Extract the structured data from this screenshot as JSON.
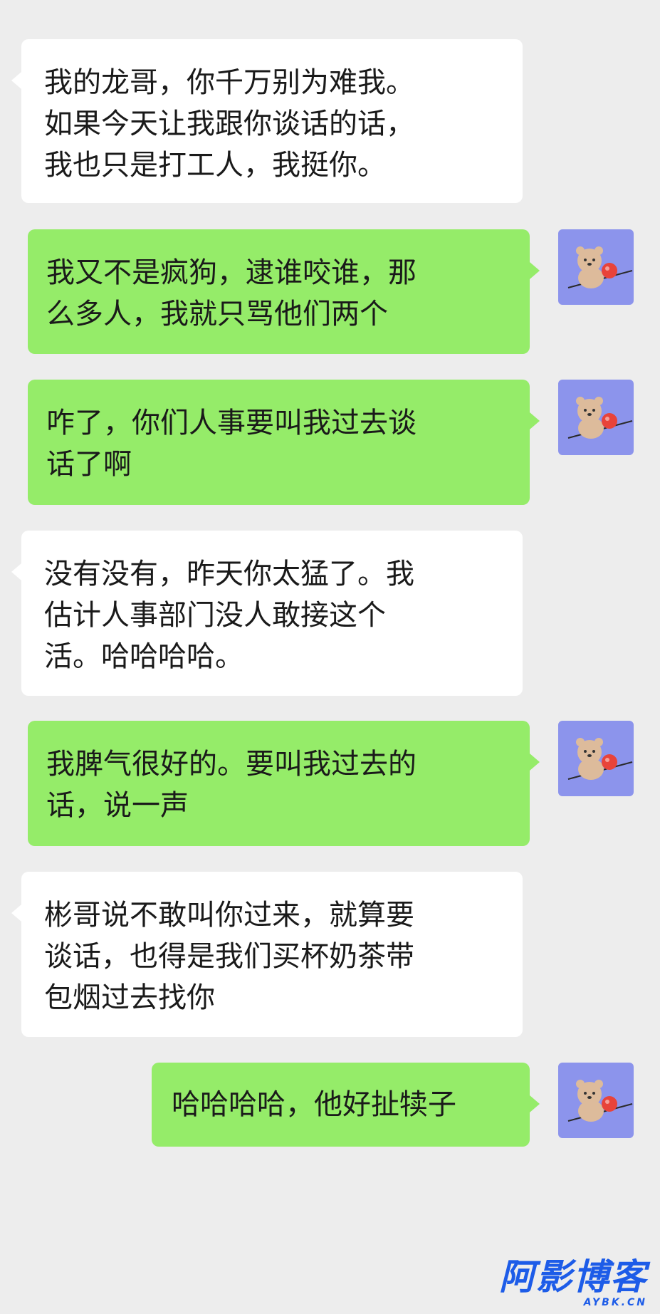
{
  "chat": {
    "messages": [
      {
        "side": "incoming",
        "text": "我的龙哥，你千万别为难我。\n如果今天让我跟你谈话的话，\n我也只是打工人，我挺你。"
      },
      {
        "side": "outgoing",
        "text": "我又不是疯狗，逮谁咬谁，那\n么多人，我就只骂他们两个"
      },
      {
        "side": "outgoing",
        "text": "咋了，你们人事要叫我过去谈\n话了啊"
      },
      {
        "side": "incoming",
        "text": "没有没有，昨天你太猛了。我\n估计人事部门没人敢接这个\n活。哈哈哈哈。"
      },
      {
        "side": "outgoing",
        "text": "我脾气很好的。要叫我过去的\n话，说一声"
      },
      {
        "side": "incoming",
        "text": "彬哥说不敢叫你过来，就算要\n谈话，也得是我们买杯奶茶带\n包烟过去找你"
      },
      {
        "side": "outgoing",
        "text": "哈哈哈哈，他好扯犊子"
      }
    ],
    "avatar_icon": "bear-sticker-avatar-icon",
    "colors": {
      "background": "#ededed",
      "incoming_bubble": "#ffffff",
      "outgoing_bubble": "#95ec69",
      "avatar_bg": "#8c94ec"
    }
  },
  "watermark": {
    "main": "阿影博客",
    "sub": "AYBK.CN",
    "color": "#1d5ce8"
  }
}
